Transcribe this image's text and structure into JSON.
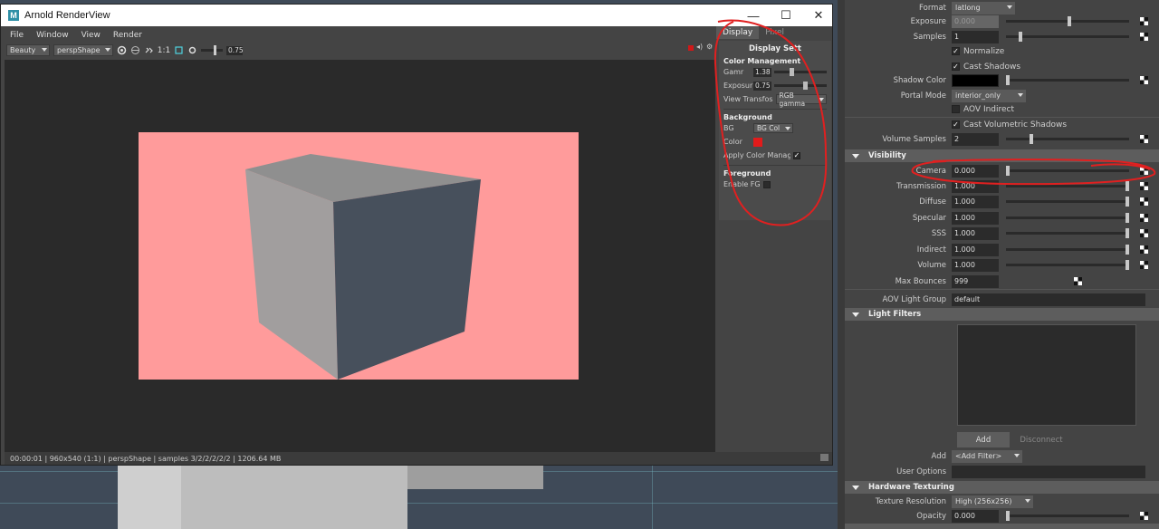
{
  "window": {
    "title": "Arnold RenderView",
    "logo": "M",
    "minimize_glyph": "—",
    "maximize_glyph": "☐",
    "close_glyph": "✕"
  },
  "menu": [
    "File",
    "Window",
    "View",
    "Render"
  ],
  "toolbar": {
    "aov": "Beauty",
    "camera": "perspShape",
    "ratio": "1:1",
    "exposure_value": "0.75",
    "exposure_level": 0.6
  },
  "status_bar": "00:00:01 | 960x540 (1:1) | perspShape  | samples 3/2/2/2/2/2 | 1206.64 MB",
  "display_panel": {
    "tabs": [
      "Display",
      "Pixel"
    ],
    "title": "Display Sett",
    "color_management": {
      "heading": "Color Management",
      "gamma_label": "Gamr",
      "gamma_value": "1.38",
      "gamma_level": 0.3,
      "exposure_label": "Exposur",
      "exposure_value": "0.75",
      "exposure_level": 0.55,
      "view_transform_label": "View Transfos",
      "view_transform_value": "RGB gamma"
    },
    "background": {
      "heading": "Background",
      "bg_label": "BG",
      "bg_value": "BG Col",
      "color_label": "Color",
      "color": "#e21b1b",
      "apply_cm_label": "Apply Color Manag"
    },
    "foreground": {
      "heading": "Foreground",
      "enable_fg_label": "Enable FG"
    }
  },
  "render": {
    "background_color": "#ff9b9b",
    "cube_top_color": "#8f8f8f",
    "cube_left_color": "#a19e9e",
    "cube_right_color": "#47505c"
  },
  "attribute_editor": {
    "format_label": "Format",
    "format_value": "latlong",
    "exposure_label": "Exposure",
    "exposure_value": "0.000",
    "samples_label": "Samples",
    "samples_value": "1",
    "normalize_label": "Normalize",
    "cast_shadows_label": "Cast Shadows",
    "shadow_color_label": "Shadow Color",
    "portal_mode_label": "Portal Mode",
    "portal_mode_value": "interior_only",
    "aov_indirect_label": "AOV Indirect",
    "cast_vol_shadows_label": "Cast Volumetric Shadows",
    "volume_samples_label": "Volume Samples",
    "volume_samples_value": "2",
    "visibility_heading": "Visibility",
    "visibility": [
      {
        "label": "Camera",
        "value": "0.000",
        "level": 0
      },
      {
        "label": "Transmission",
        "value": "1.000",
        "level": 1
      },
      {
        "label": "Diffuse",
        "value": "1.000",
        "level": 1
      },
      {
        "label": "Specular",
        "value": "1.000",
        "level": 1
      },
      {
        "label": "SSS",
        "value": "1.000",
        "level": 1
      },
      {
        "label": "Indirect",
        "value": "1.000",
        "level": 1
      },
      {
        "label": "Volume",
        "value": "1.000",
        "level": 1
      }
    ],
    "max_bounces_label": "Max Bounces",
    "max_bounces_value": "999",
    "aov_light_group_label": "AOV Light Group",
    "aov_light_group_value": "default",
    "light_filters_heading": "Light Filters",
    "add_button": "Add",
    "disconnect_button": "Disconnect",
    "add_label": "Add",
    "add_filter_value": "<Add Filter>",
    "user_options_label": "User Options",
    "hardware_texturing_heading": "Hardware Texturing",
    "texture_resolution_label": "Texture Resolution",
    "texture_resolution_value": "High (256x256)",
    "opacity_label": "Opacity",
    "opacity_value": "0.000"
  },
  "annotation_color": "#e02020"
}
